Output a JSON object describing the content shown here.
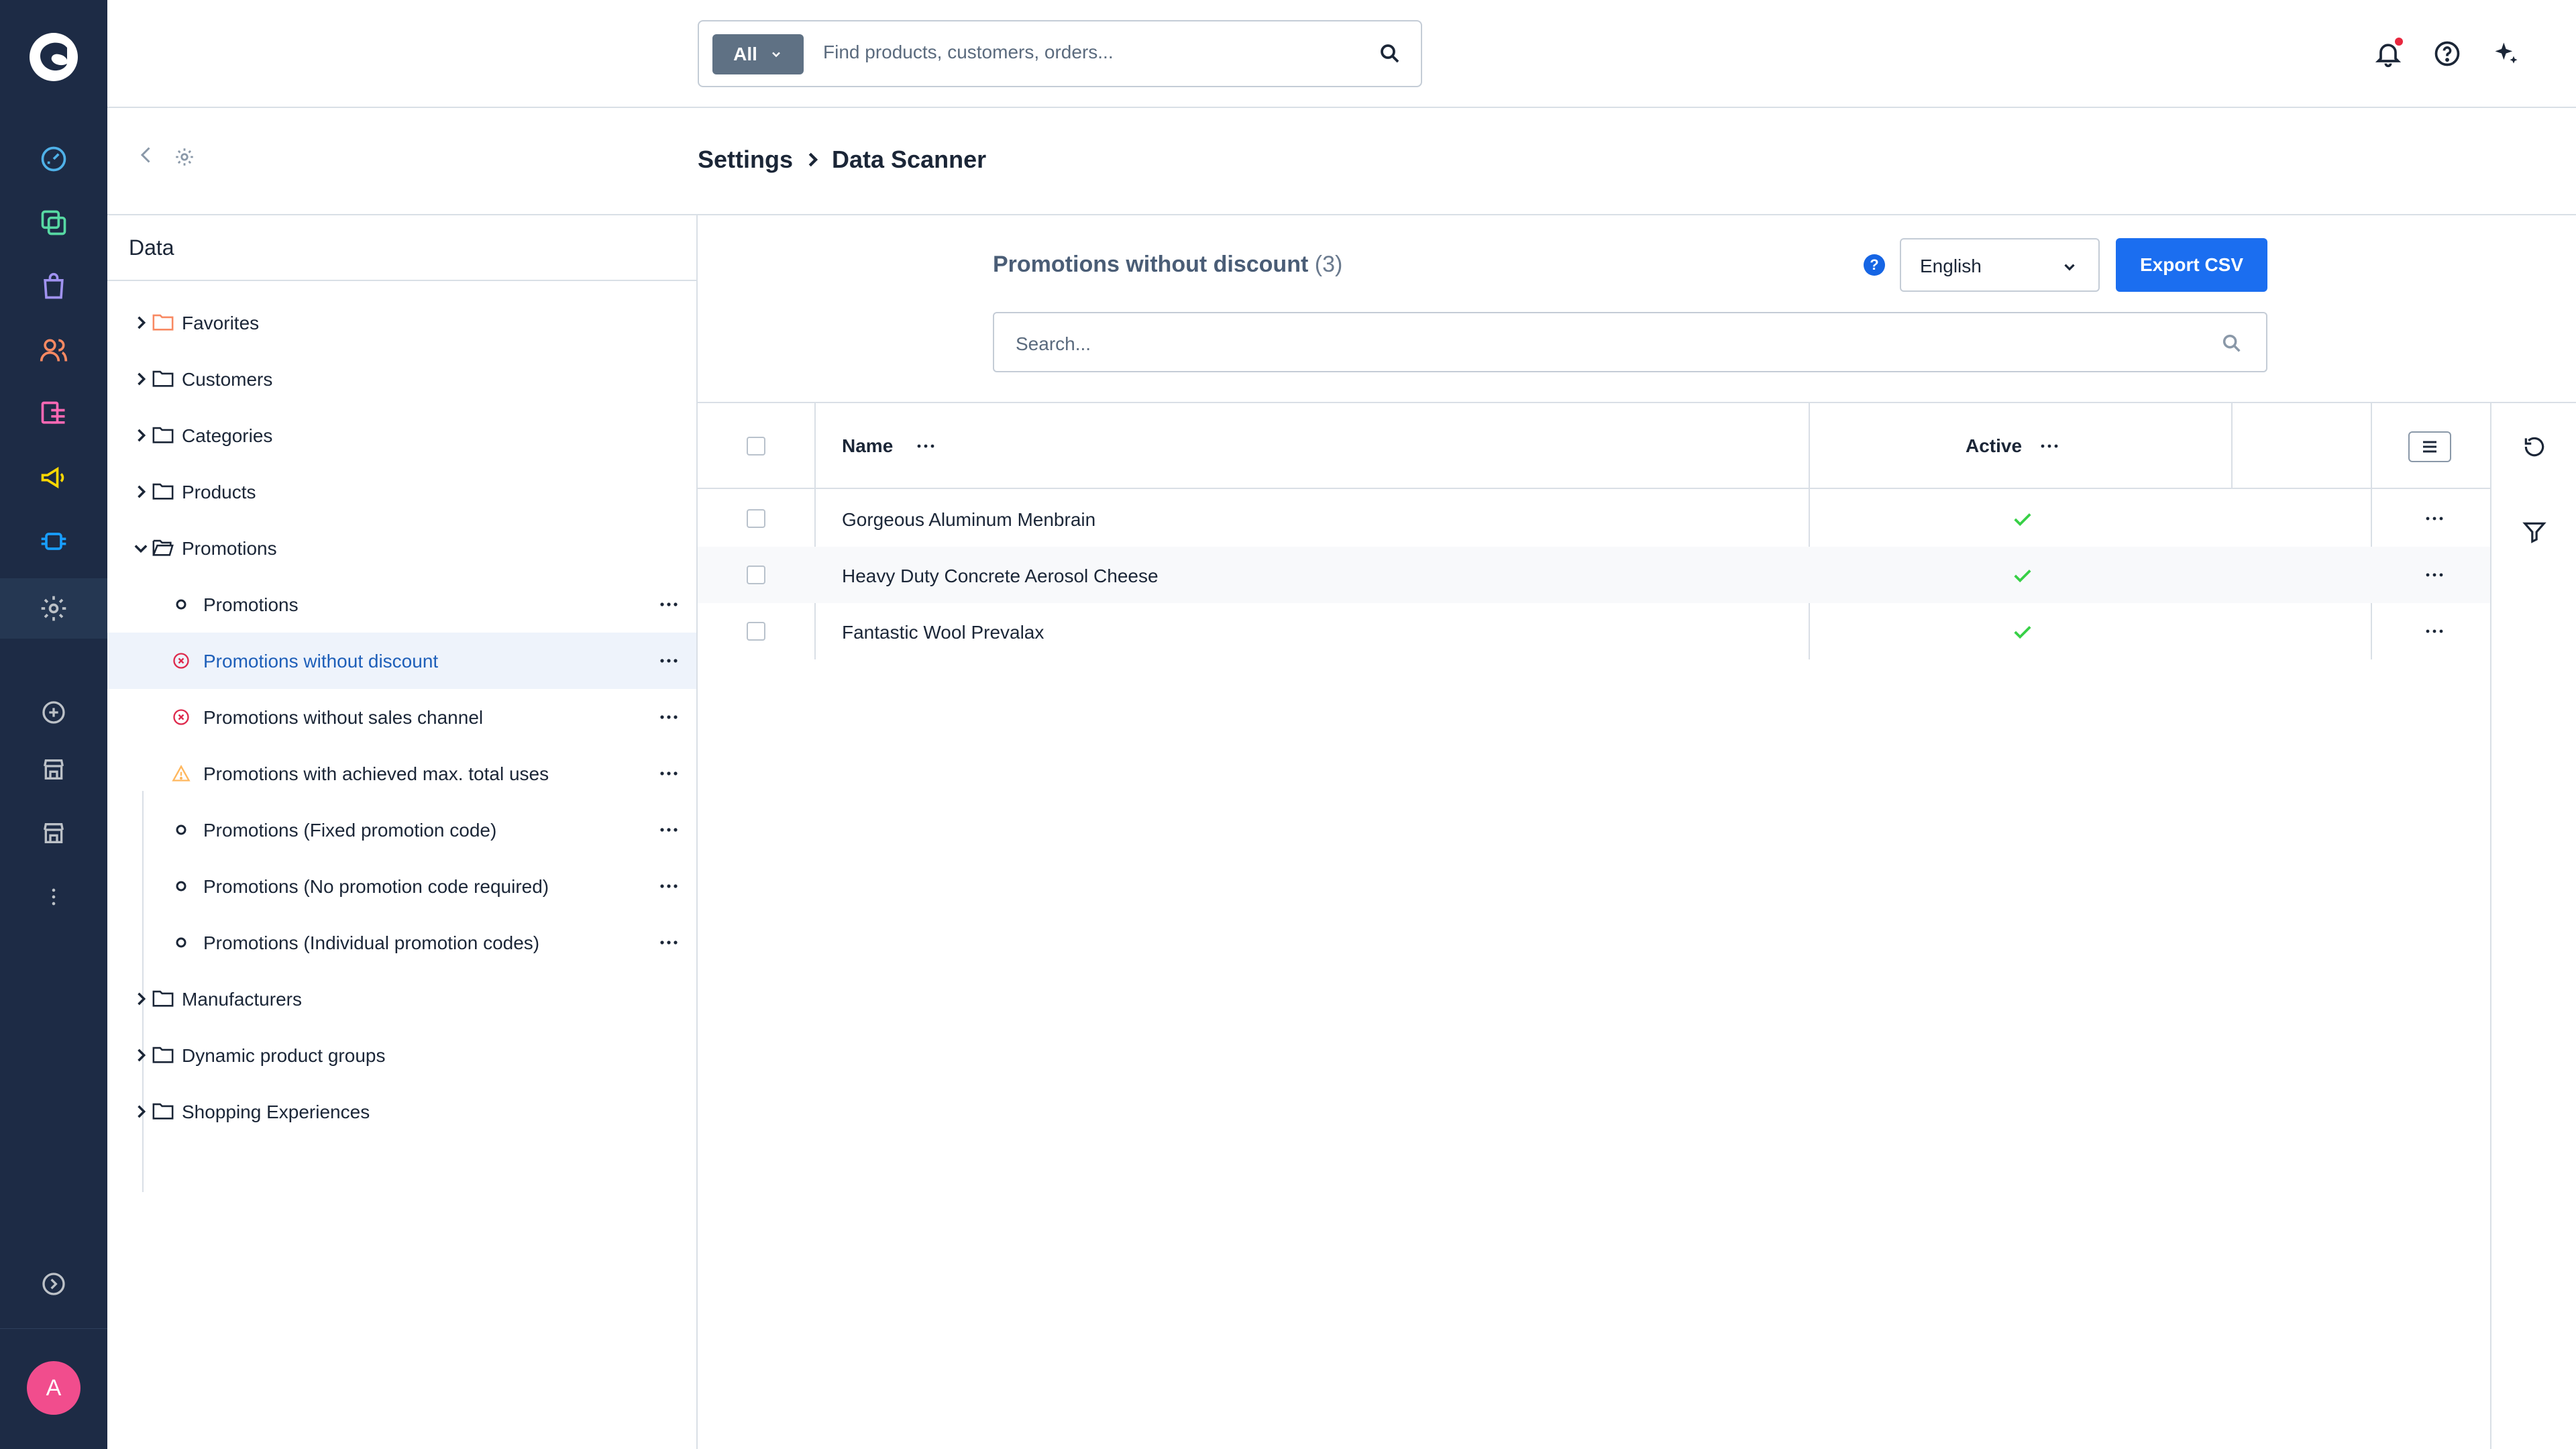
{
  "app": {
    "avatar_initial": "A",
    "nav_items": [
      {
        "name": "dashboard-icon",
        "color": "#4fb1e8"
      },
      {
        "name": "catalog-icon",
        "color": "#57d9a3"
      },
      {
        "name": "orders-icon",
        "color": "#a092f0"
      },
      {
        "name": "customers-icon",
        "color": "#f88962"
      },
      {
        "name": "content-icon",
        "color": "#ff68b4"
      },
      {
        "name": "marketing-icon",
        "color": "#ffd700"
      },
      {
        "name": "extensions-icon",
        "color": "#189eff"
      },
      {
        "name": "settings-icon",
        "color": "#bcc1c7"
      }
    ]
  },
  "topbar": {
    "search_scope": "All",
    "search_placeholder": "Find products, customers, orders..."
  },
  "breadcrumb": {
    "parent": "Settings",
    "current": "Data Scanner"
  },
  "tree": {
    "title": "Data",
    "folders_top": [
      {
        "label": "Favorites",
        "accent": "#f88962"
      },
      {
        "label": "Customers"
      },
      {
        "label": "Categories"
      },
      {
        "label": "Products"
      }
    ],
    "open_folder": "Promotions",
    "children": [
      {
        "label": "Promotions",
        "status": "neutral"
      },
      {
        "label": "Promotions without discount",
        "status": "error",
        "selected": true
      },
      {
        "label": "Promotions without sales channel",
        "status": "error"
      },
      {
        "label": "Promotions with achieved max. total uses",
        "status": "warning"
      },
      {
        "label": "Promotions (Fixed promotion code)",
        "status": "neutral"
      },
      {
        "label": "Promotions (No promotion code required)",
        "status": "neutral"
      },
      {
        "label": "Promotions (Individual promotion codes)",
        "status": "neutral"
      }
    ],
    "folders_bottom": [
      {
        "label": "Manufacturers"
      },
      {
        "label": "Dynamic product groups"
      },
      {
        "label": "Shopping Experiences"
      }
    ]
  },
  "content": {
    "title": "Promotions without discount",
    "count": "(3)",
    "language": "English",
    "export_label": "Export CSV",
    "search_placeholder": "Search...",
    "columns": {
      "name": "Name",
      "active": "Active"
    },
    "rows": [
      {
        "name": "Gorgeous Aluminum Menbrain",
        "active": true
      },
      {
        "name": "Heavy Duty Concrete Aerosol Cheese",
        "active": true
      },
      {
        "name": "Fantastic Wool Prevalax",
        "active": true
      }
    ]
  },
  "colors": {
    "rail_bg": "#1d2b45",
    "primary": "#1b6ef0",
    "error": "#de294c",
    "warning": "#ffb75d",
    "success": "#37d046",
    "avatar": "#f14d8d"
  }
}
